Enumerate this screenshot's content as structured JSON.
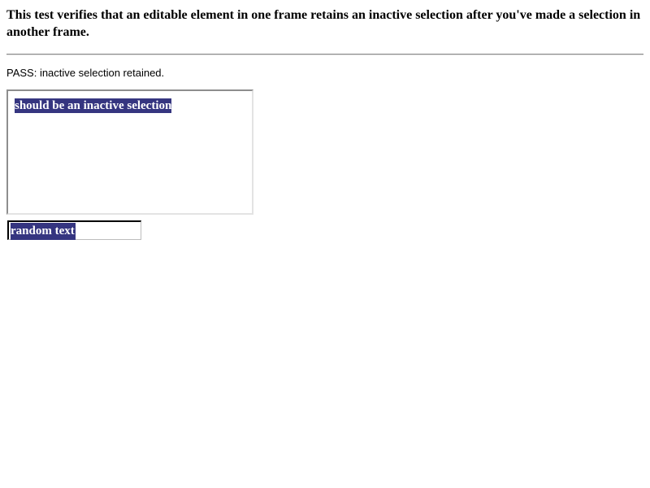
{
  "test": {
    "description": "This test verifies that an editable element in one frame retains an inactive selection after you've made a selection in another frame.",
    "result": "PASS: inactive selection retained."
  },
  "frame": {
    "selected_text": "should be an inactive selection"
  },
  "input": {
    "value": "random text"
  },
  "colors": {
    "selection_background": "#353580",
    "selection_text": "#ffffff"
  }
}
